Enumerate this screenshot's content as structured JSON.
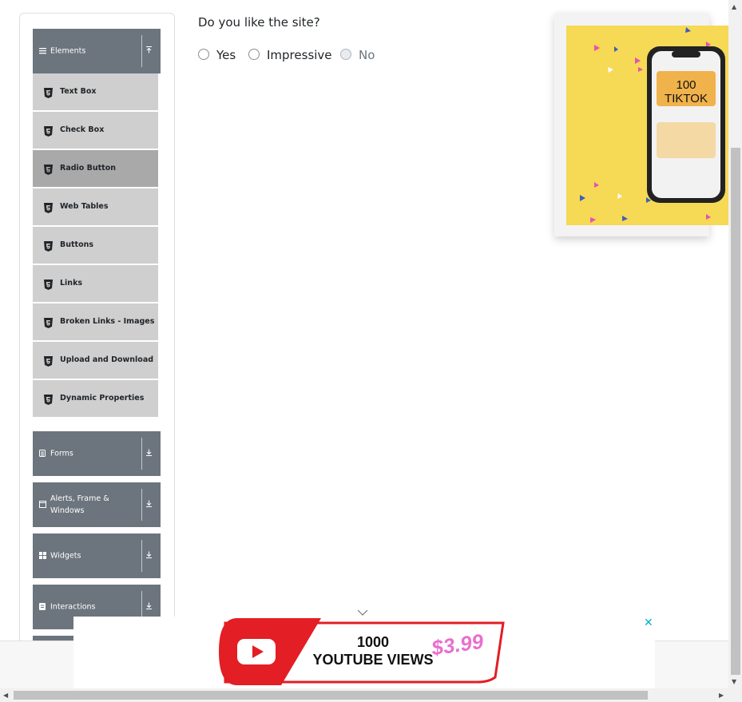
{
  "sidebar": {
    "elements_group": {
      "label": "Elements",
      "icon": "hamburger-icon",
      "toggle_icon": "arrow-up-icon"
    },
    "items": [
      {
        "label": "Text Box",
        "active": false
      },
      {
        "label": "Check Box",
        "active": false
      },
      {
        "label": "Radio Button",
        "active": true
      },
      {
        "label": "Web Tables",
        "active": false
      },
      {
        "label": "Buttons",
        "active": false
      },
      {
        "label": "Links",
        "active": false
      },
      {
        "label": "Broken Links - Images",
        "active": false
      },
      {
        "label": "Upload and Download",
        "active": false
      },
      {
        "label": "Dynamic Properties",
        "active": false
      }
    ],
    "groups": [
      {
        "label": "Forms",
        "icon": "form-icon"
      },
      {
        "label": "Alerts, Frame & Windows",
        "icon": "window-icon"
      },
      {
        "label": "Widgets",
        "icon": "grid-icon"
      },
      {
        "label": "Interactions",
        "icon": "list-icon"
      }
    ]
  },
  "main": {
    "question": "Do you like the site?",
    "options": [
      {
        "label": "Yes",
        "disabled": false,
        "checked": false
      },
      {
        "label": "Impressive",
        "disabled": false,
        "checked": false
      },
      {
        "label": "No",
        "disabled": true,
        "checked": false
      }
    ]
  },
  "ads": {
    "side": {
      "line1": "100",
      "line2": "TIKTOK"
    },
    "bottom": {
      "line1": "1000",
      "line2": "YOUTUBE VIEWS",
      "price": "$3.99",
      "close": "✕"
    }
  },
  "colors": {
    "sidebar_group": "#6c757d",
    "menu_item": "#cfcfcf",
    "menu_item_active": "#a9a9a9",
    "ad_yellow": "#f6d955",
    "ad_orange": "#f0b24b",
    "youtube_red": "#e31e24",
    "price_pink": "#e86fcf"
  }
}
